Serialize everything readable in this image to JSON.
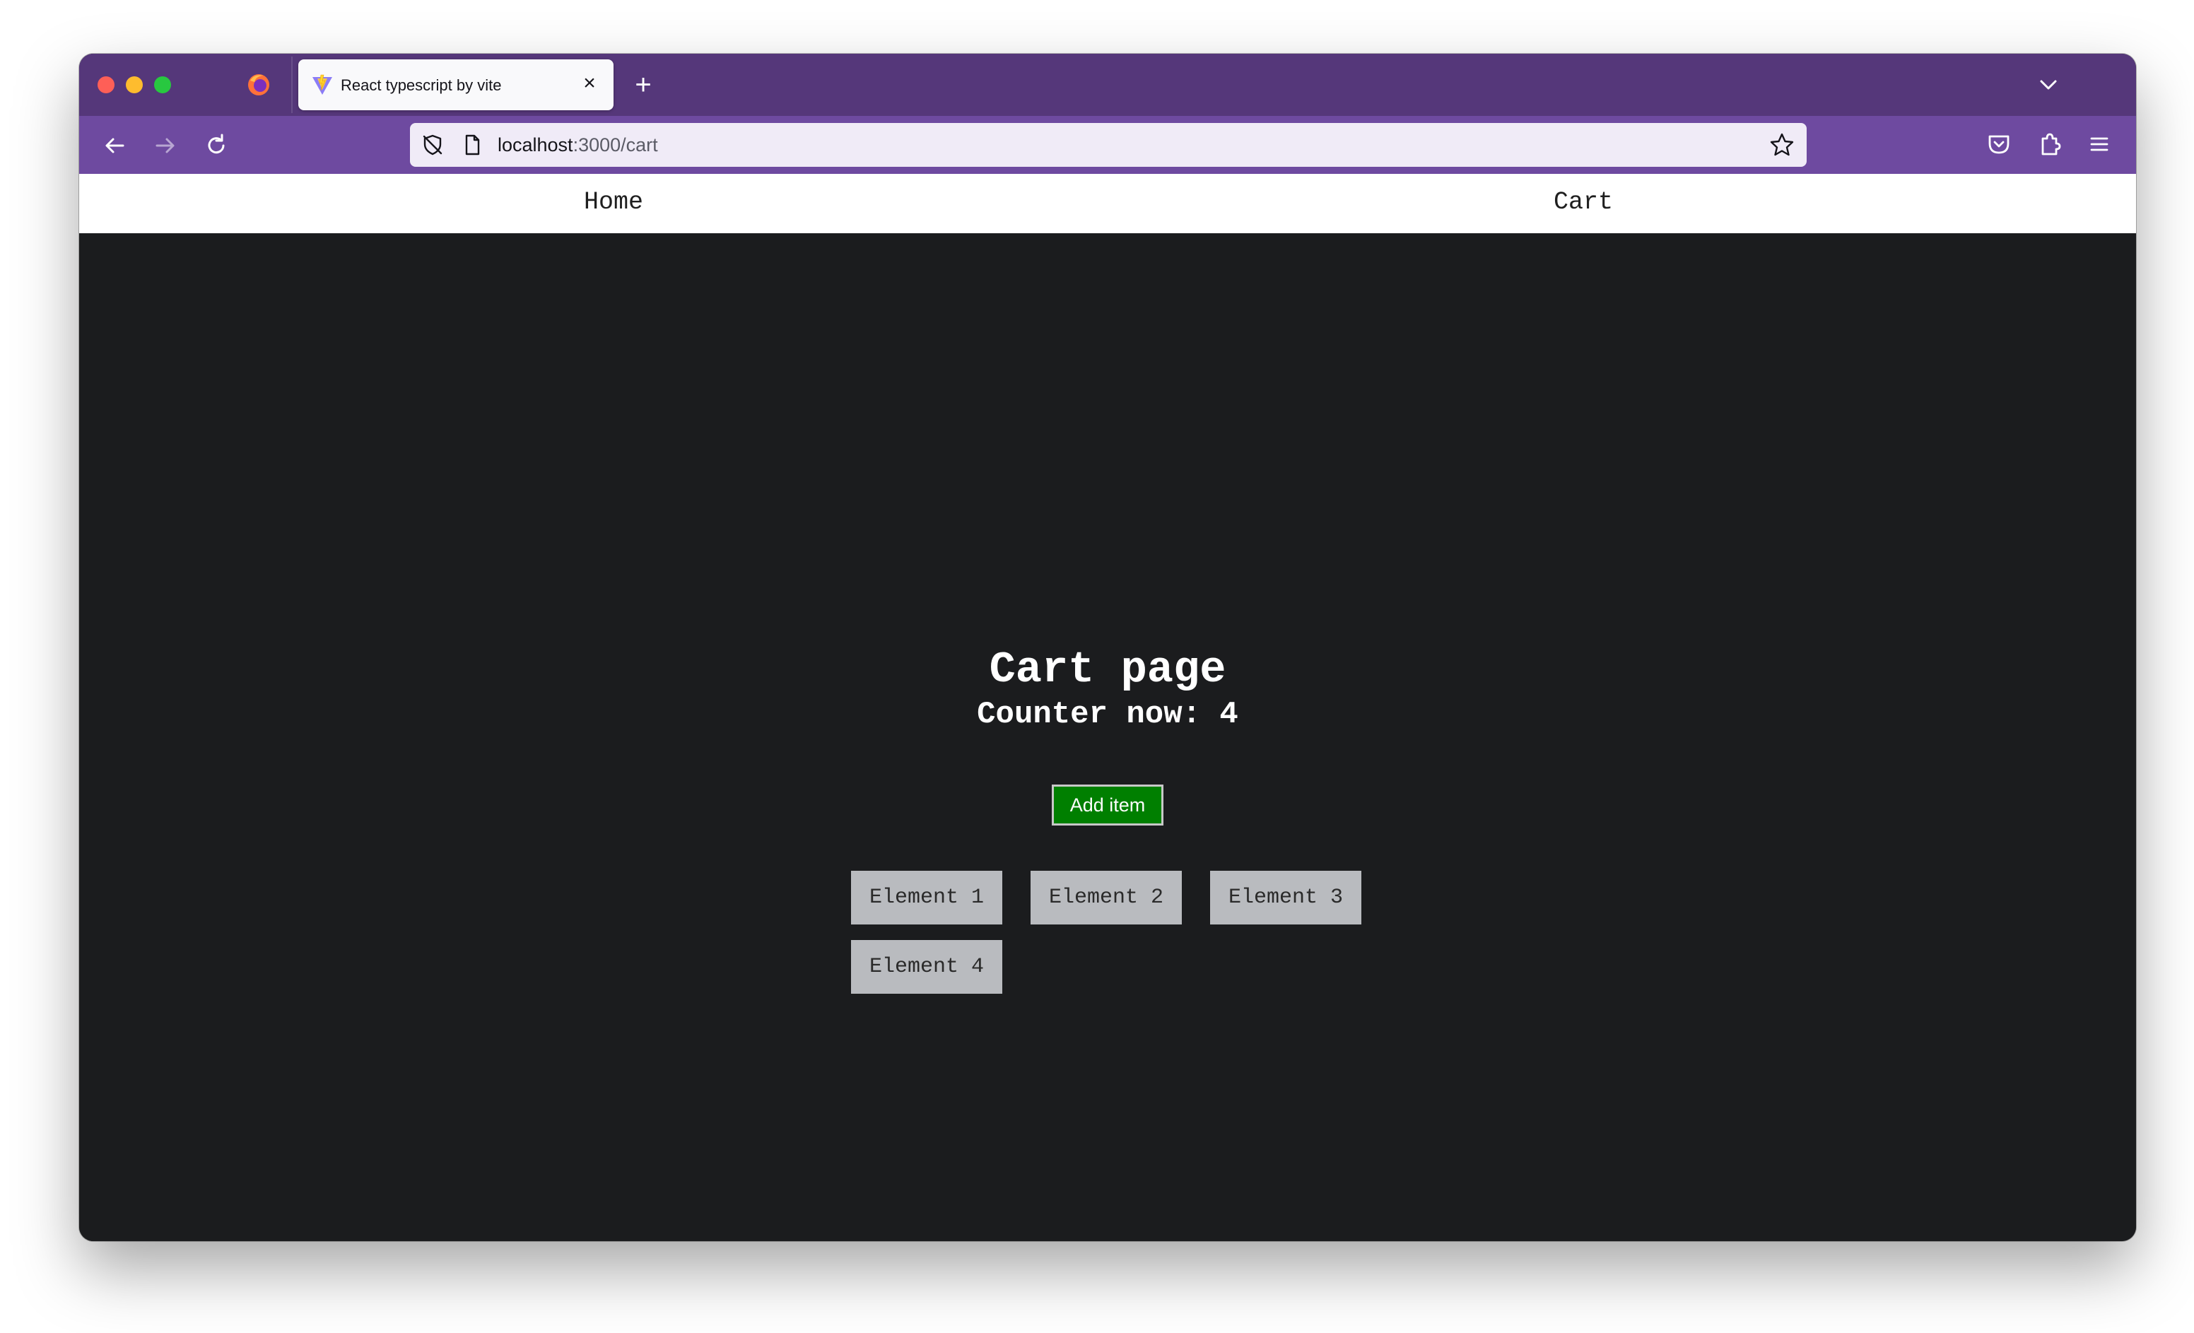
{
  "browser": {
    "tab": {
      "title": "React typescript by vite",
      "close_glyph": "×"
    },
    "new_tab_glyph": "+",
    "url": {
      "host": "localhost",
      "rest": ":3000/cart"
    },
    "colors": {
      "tabstrip": "#55377a",
      "navbar": "#6e4aa0",
      "urlbar": "#f0ebf7"
    }
  },
  "nav": {
    "home_label": "Home",
    "cart_label": "Cart"
  },
  "main": {
    "title": "Cart page",
    "counter_label": "Counter now:",
    "counter_value": "4",
    "add_button_label": "Add item",
    "add_button_color": "#007f00",
    "elements": [
      "Element 1",
      "Element 2",
      "Element 3",
      "Element 4"
    ]
  }
}
